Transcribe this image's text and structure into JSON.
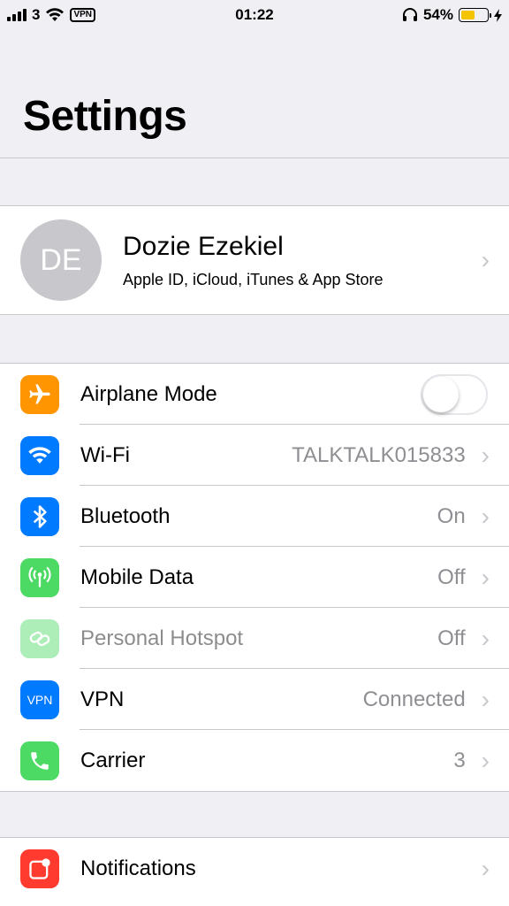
{
  "status_bar": {
    "carrier": "3",
    "vpn": "VPN",
    "time": "01:22",
    "battery": "54%",
    "battery_level": 0.54
  },
  "title": "Settings",
  "profile": {
    "initials": "DE",
    "name": "Dozie Ezekiel",
    "subtitle": "Apple ID, iCloud, iTunes & App Store"
  },
  "settings": [
    {
      "label": "Airplane Mode",
      "value": "",
      "icon": "airplane-icon",
      "color": "#ff9500",
      "toggle": false
    },
    {
      "label": "Wi-Fi",
      "value": "TALKTALK015833",
      "icon": "wifi-icon",
      "color": "#007aff"
    },
    {
      "label": "Bluetooth",
      "value": "On",
      "icon": "bluetooth-icon",
      "color": "#007aff"
    },
    {
      "label": "Mobile Data",
      "value": "Off",
      "icon": "antenna-icon",
      "color": "#4cd964"
    },
    {
      "label": "Personal Hotspot",
      "value": "Off",
      "icon": "hotspot-icon",
      "color": "#4cd964",
      "disabled": true
    },
    {
      "label": "VPN",
      "value": "Connected",
      "icon": "vpn-icon",
      "color": "#007aff",
      "icon_text": "VPN"
    },
    {
      "label": "Carrier",
      "value": "3",
      "icon": "phone-icon",
      "color": "#4cd964"
    }
  ],
  "notifications": {
    "label": "Notifications",
    "icon": "notifications-icon",
    "color": "#ff3b30"
  }
}
